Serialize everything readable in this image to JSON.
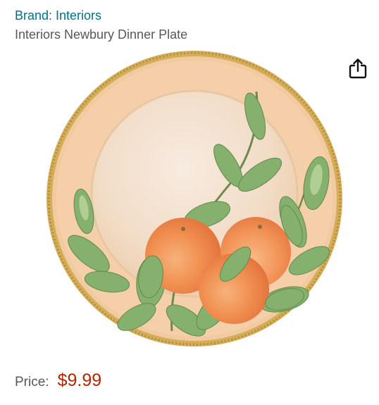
{
  "product": {
    "brand_label": "Brand: Interiors",
    "title": "Interiors Newbury Dinner Plate",
    "image_subject": "dinner plate with orange fruit and leaf design, beaded gold rim"
  },
  "actions": {
    "share_icon": "share-icon"
  },
  "pricing": {
    "label": "Price:",
    "value": "$9.99"
  },
  "colors": {
    "link": "#007185",
    "title_text": "#565959",
    "price": "#b12704",
    "plate_peach": "#f3cfa8",
    "plate_center": "#f4e3d2",
    "rim_gold": "#c9a24a",
    "orange": "#f08a4a",
    "leaf": "#7fae6a"
  }
}
